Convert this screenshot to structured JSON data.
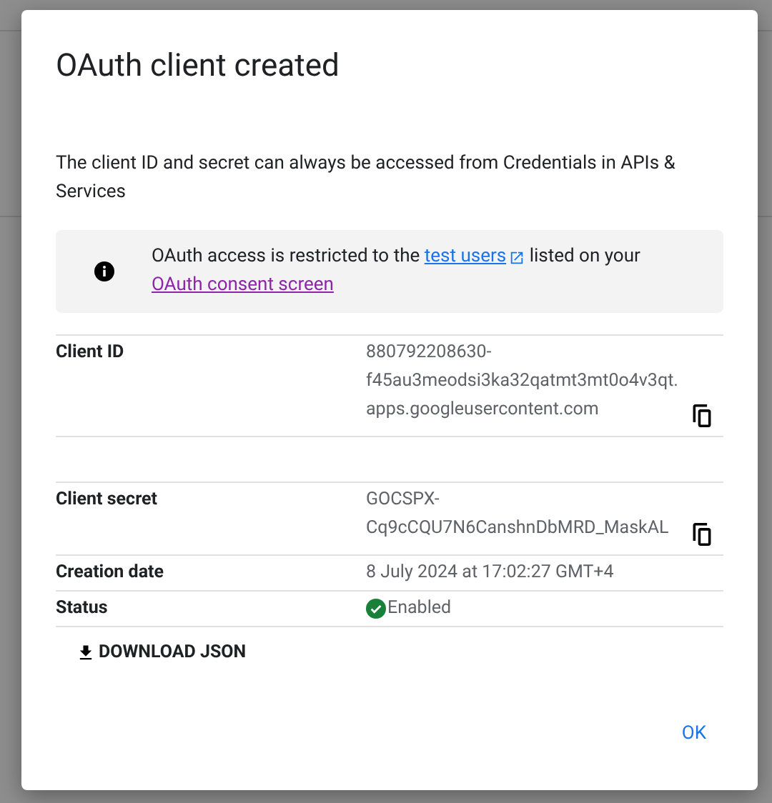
{
  "dialog": {
    "title": "OAuth client created",
    "description": "The client ID and secret can always be accessed from Credentials in APIs & Services",
    "notice": {
      "before": "OAuth access is restricted to the",
      "link": "test users",
      "middle": "listed on your",
      "link2": "OAuth consent screen"
    },
    "fields": [
      {
        "label": "Client ID",
        "value": "880792208630-f45au3meodsi3ka32qatmt3mt0o4v3qt.apps.googleusercontent.com",
        "kind": "copy"
      },
      {
        "kind": "spacer"
      },
      {
        "label": "Client secret",
        "value": "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",
        "kind": "copy"
      },
      {
        "label": "Creation date",
        "value": "8 July 2024 at 17:02:27 GMT+4",
        "kind": "text"
      },
      {
        "label": "Status",
        "value": "Enabled",
        "kind": "status"
      }
    ],
    "download": "DOWNLOAD JSON",
    "ok": "OK"
  }
}
